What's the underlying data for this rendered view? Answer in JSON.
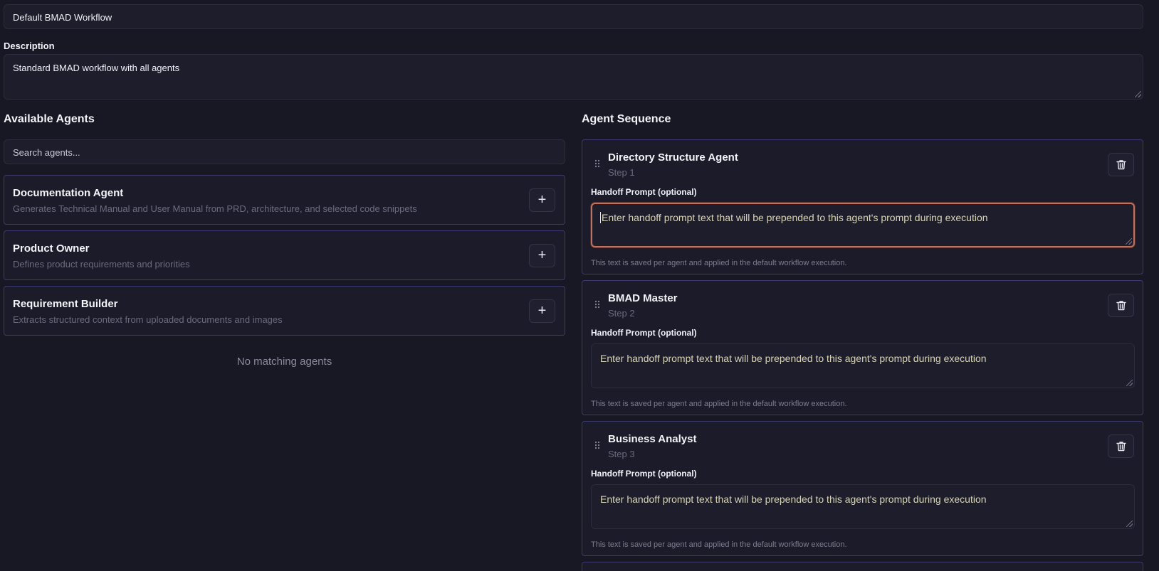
{
  "workflow": {
    "name_value": "Default BMAD Workflow",
    "description_label": "Description",
    "description_value": "Standard BMAD workflow with all agents"
  },
  "available": {
    "title": "Available Agents",
    "search_placeholder": "Search agents...",
    "agents": [
      {
        "name": "Documentation Agent",
        "description": "Generates Technical Manual and User Manual from PRD, architecture, and selected code snippets",
        "add_label": "+"
      },
      {
        "name": "Product Owner",
        "description": "Defines product requirements and priorities",
        "add_label": "+"
      },
      {
        "name": "Requirement Builder",
        "description": "Extracts structured context from uploaded documents and images",
        "add_label": "+"
      }
    ],
    "empty_text": "No matching agents"
  },
  "sequence": {
    "title": "Agent Sequence",
    "steps": [
      {
        "name": "Directory Structure Agent",
        "step": "Step 1",
        "handoff_label": "Handoff Prompt (optional)",
        "placeholder": "Enter handoff prompt text that will be prepended to this agent's prompt during execution",
        "help": "This text is saved per agent and applied in the default workflow execution."
      },
      {
        "name": "BMAD Master",
        "step": "Step 2",
        "handoff_label": "Handoff Prompt (optional)",
        "placeholder": "Enter handoff prompt text that will be prepended to this agent's prompt during execution",
        "help": "This text is saved per agent and applied in the default workflow execution."
      },
      {
        "name": "Business Analyst",
        "step": "Step 3",
        "handoff_label": "Handoff Prompt (optional)",
        "placeholder": "Enter handoff prompt text that will be prepended to this agent's prompt during execution",
        "help": "This text is saved per agent and applied in the default workflow execution."
      }
    ]
  },
  "colors": {
    "background": "#181825",
    "card_border": "#3b3a6e",
    "focus_ring": "#c0725e",
    "muted_text": "#6b6b80"
  },
  "icons": {
    "add": "plus-icon",
    "remove": "trash-icon",
    "drag": "drag-handle-icon"
  }
}
